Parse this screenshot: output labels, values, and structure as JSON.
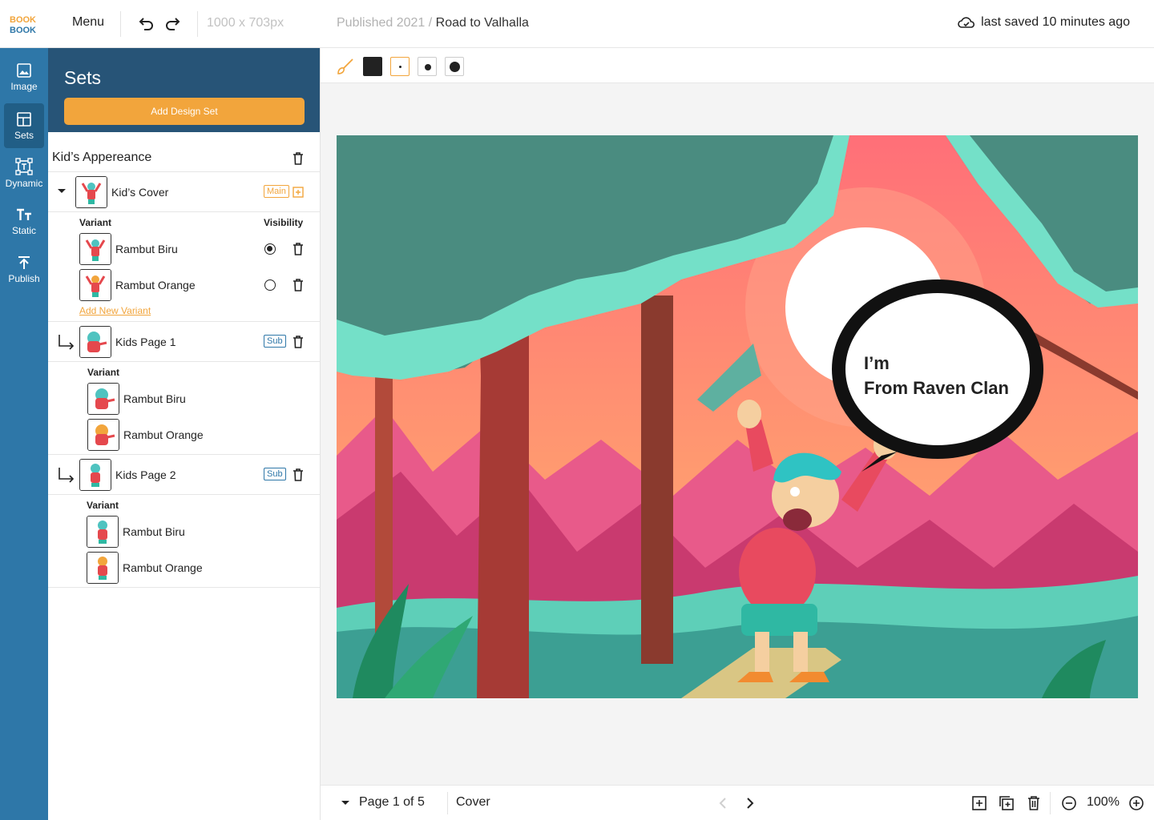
{
  "header": {
    "logo_text": "BOOK BOOK",
    "menu_label": "Menu",
    "dimensions": "1000 x 703px",
    "breadcrumb_parent": "Published 2021",
    "breadcrumb_sep": "/",
    "breadcrumb_current": "Road to Valhalla",
    "save_status": "last saved 10 minutes ago"
  },
  "rail": {
    "items": [
      {
        "label": "Image",
        "icon": "image-icon"
      },
      {
        "label": "Sets",
        "icon": "layout-icon"
      },
      {
        "label": "Dynamic",
        "icon": "dynamic-text-icon"
      },
      {
        "label": "Static",
        "icon": "static-text-icon"
      },
      {
        "label": "Publish",
        "icon": "upload-icon"
      }
    ]
  },
  "sets_panel": {
    "title": "Sets",
    "add_button": "Add Design Set",
    "group_title": "Kid’s Appereance",
    "cover": {
      "label": "Kid’s Cover",
      "tag": "Main",
      "variant_header": "Variant",
      "visibility_header": "Visibility",
      "variants": [
        {
          "label": "Rambut Biru",
          "visible": true
        },
        {
          "label": "Rambut Orange",
          "visible": false
        }
      ],
      "add_variant": "Add New Variant"
    },
    "page1": {
      "label": "Kids Page 1",
      "tag": "Sub",
      "variant_header": "Variant",
      "variants": [
        {
          "label": "Rambut Biru"
        },
        {
          "label": "Rambut Orange"
        }
      ]
    },
    "page2": {
      "label": "Kids Page 2",
      "tag": "Sub",
      "variant_header": "Variant",
      "variants": [
        {
          "label": "Rambut Biru"
        },
        {
          "label": "Rambut Orange"
        }
      ]
    }
  },
  "toolbar": {
    "swatch_color": "#222222",
    "accent": "#f2a53c"
  },
  "canvas": {
    "bubble_line1": "I’m",
    "bubble_line2": "From Raven Clan"
  },
  "footer": {
    "page_indicator": "Page 1 of 5",
    "page_name": "Cover",
    "zoom": "100%"
  },
  "colors": {
    "rail_bg": "#2e77a8",
    "panel_head": "#275477",
    "accent_orange": "#f2a53c",
    "sky": "#ff8f73",
    "mountain": "#e85a8a",
    "foliage": "#4f9c8c"
  }
}
